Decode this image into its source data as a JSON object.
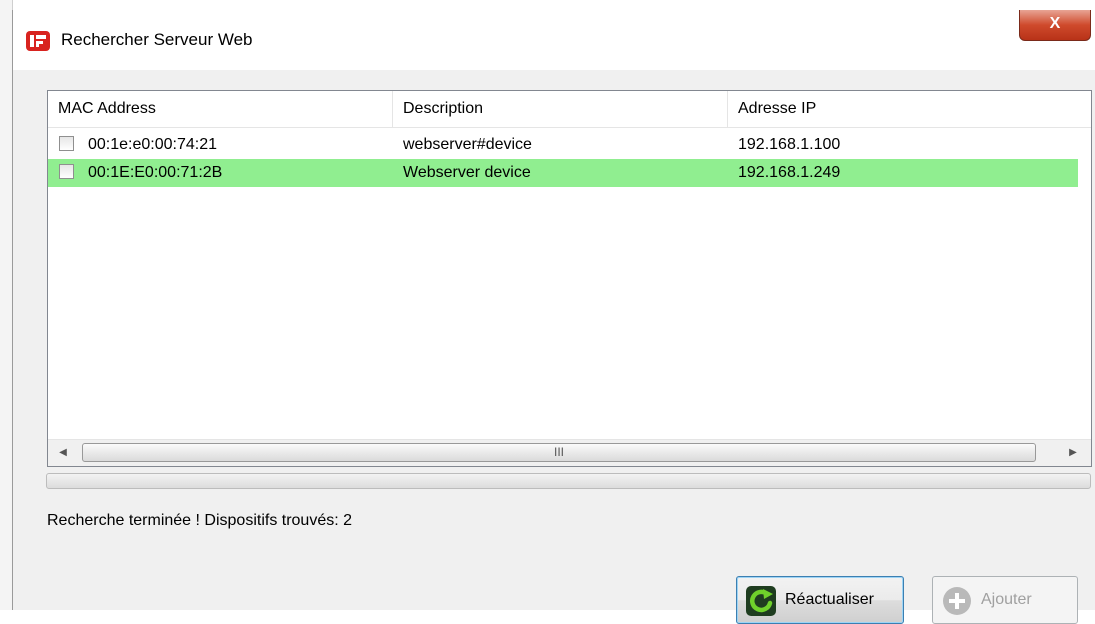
{
  "window": {
    "title": "Rechercher Serveur Web",
    "close_label": "X"
  },
  "table": {
    "columns": [
      "MAC Address",
      "Description",
      "Adresse IP"
    ],
    "rows": [
      {
        "mac": "00:1e:e0:00:74:21",
        "description": "webserver#device",
        "ip": "192.168.1.100",
        "checked": false,
        "highlighted": false
      },
      {
        "mac": "00:1E:E0:00:71:2B",
        "description": "Webserver device",
        "ip": "192.168.1.249",
        "checked": false,
        "highlighted": true
      }
    ],
    "highlight_color": "#90ee90",
    "scroll_thumb_grip": "III"
  },
  "progress": {
    "value_percent": 0
  },
  "status_text": "Recherche terminée ! Dispositifs trouvés: 2",
  "buttons": {
    "refresh_label": "Réactualiser",
    "add_label": "Ajouter"
  },
  "icons": {
    "app": "web-server-app-icon",
    "refresh": "green-refresh-icon",
    "add": "plus-circle-icon"
  }
}
